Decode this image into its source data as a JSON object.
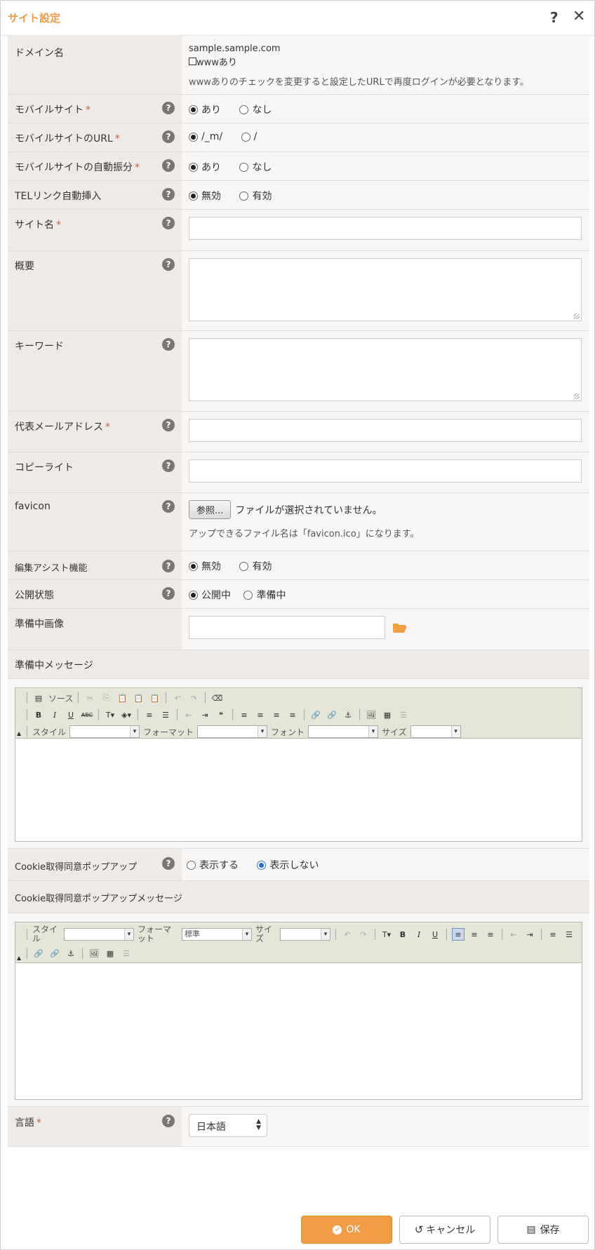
{
  "dialog": {
    "title": "サイト設定",
    "help_icon": "?",
    "close_icon": "✕"
  },
  "domain": {
    "label": "ドメイン名",
    "value": "sample.sample.com",
    "www_checkbox_label": "wwwあり",
    "note": "wwwありのチェックを変更すると設定したURLで再度ログインが必要となります。"
  },
  "mobile_site": {
    "label": "モバイルサイト",
    "required": "*",
    "options": [
      "あり",
      "なし"
    ],
    "selected": "あり"
  },
  "mobile_url": {
    "label": "モバイルサイトのURL",
    "required": "*",
    "options": [
      "/_m/",
      "/"
    ],
    "selected": "/_m/"
  },
  "mobile_redirect": {
    "label": "モバイルサイトの自動振分",
    "required": "*",
    "options": [
      "あり",
      "なし"
    ],
    "selected": "あり"
  },
  "tel_link": {
    "label": "TELリンク自動挿入",
    "options": [
      "無効",
      "有効"
    ],
    "selected": "無効"
  },
  "site_name": {
    "label": "サイト名",
    "required": "*",
    "value": ""
  },
  "summary": {
    "label": "概要",
    "value": ""
  },
  "keywords": {
    "label": "キーワード",
    "value": ""
  },
  "email": {
    "label": "代表メールアドレス",
    "required": "*",
    "value": ""
  },
  "copyright": {
    "label": "コピーライト",
    "value": ""
  },
  "favicon": {
    "label": "favicon",
    "browse_label": "参照...",
    "no_file_text": "ファイルが選択されていません。",
    "note": "アップできるファイル名は「favicon.ico」になります。"
  },
  "edit_assist": {
    "label": "編集アシスト機能",
    "options": [
      "無効",
      "有効"
    ],
    "selected": "無効"
  },
  "publish_state": {
    "label": "公開状態",
    "options": [
      "公開中",
      "準備中"
    ],
    "selected": "公開中"
  },
  "prep_image": {
    "label": "準備中画像",
    "value": ""
  },
  "prep_message": {
    "label": "準備中メッセージ",
    "toolbar": {
      "source_label": "ソース",
      "style_label": "スタイル",
      "format_label": "フォーマット",
      "font_label": "フォント",
      "size_label": "サイズ"
    }
  },
  "cookie_popup": {
    "label": "Cookie取得同意ポップアップ",
    "options": [
      "表示する",
      "表示しない"
    ],
    "selected": "表示しない"
  },
  "cookie_message": {
    "label": "Cookie取得同意ポップアップメッセージ",
    "toolbar": {
      "style_label": "スタイル",
      "format_label": "フォーマット",
      "format_value": "標準",
      "size_label": "サイズ"
    }
  },
  "language": {
    "label": "言語",
    "required": "*",
    "value": "日本語"
  },
  "buttons": {
    "ok": "OK",
    "cancel": "キャンセル",
    "save": "保存"
  },
  "colors": {
    "accent": "#f29c45",
    "label_bg": "#efeae5",
    "value_bg": "#f8f7f6",
    "required": "#e0503c"
  }
}
